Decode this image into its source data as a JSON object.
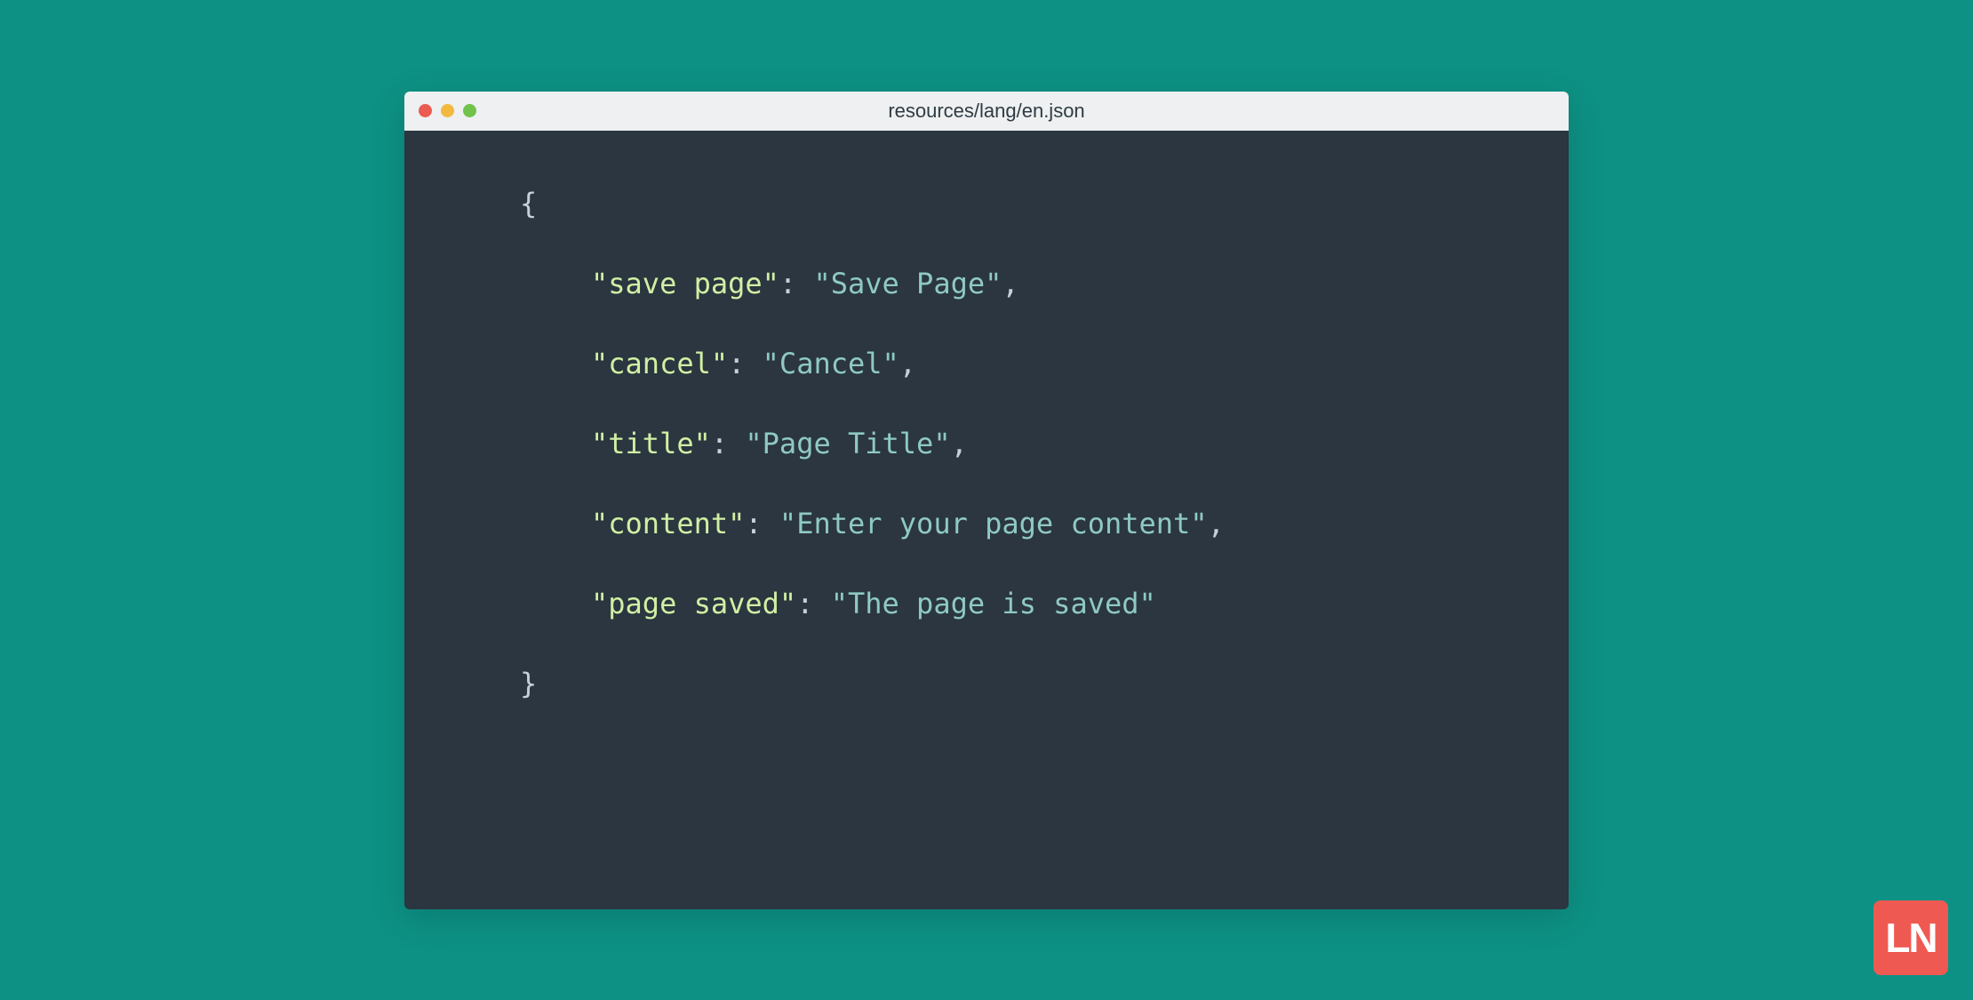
{
  "window": {
    "title": "resources/lang/en.json"
  },
  "code": {
    "open": "{",
    "close": "}",
    "comma": ",",
    "colon": ": ",
    "entries": [
      {
        "key": "\"save page\"",
        "value": "\"Save Page\""
      },
      {
        "key": "\"cancel\"",
        "value": "\"Cancel\""
      },
      {
        "key": "\"title\"",
        "value": "\"Page Title\""
      },
      {
        "key": "\"content\"",
        "value": "\"Enter your page content\""
      },
      {
        "key": "\"page saved\"",
        "value": "\"The page is saved\""
      }
    ]
  },
  "logo": {
    "text": "LN"
  }
}
